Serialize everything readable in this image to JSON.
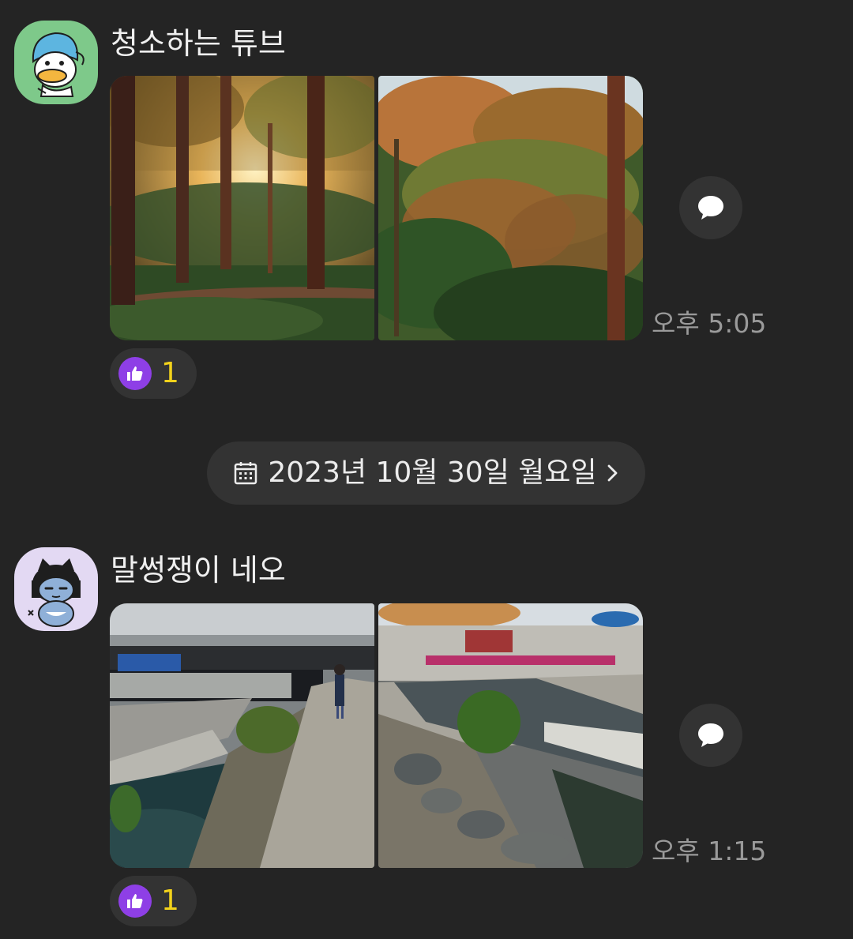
{
  "messages": [
    {
      "sender": "청소하는 튜브",
      "avatar_icon": "tube-duck-character-icon",
      "photos": [
        "autumn-forest-sunlight-photo",
        "autumn-hillside-trees-photo"
      ],
      "time": "오후 5:05",
      "reaction": {
        "icon": "thumbs-up-icon",
        "count": "1"
      }
    },
    {
      "sender": "말썽쟁이 네오",
      "avatar_icon": "neo-cat-character-icon",
      "photos": [
        "stream-walkway-under-bridge-photo",
        "stream-with-stepping-stones-photo"
      ],
      "time": "오후 1:15",
      "reaction": {
        "icon": "thumbs-up-icon",
        "count": "1"
      }
    }
  ],
  "date_divider": {
    "icon": "calendar-icon",
    "label": "2023년 10월 30일 월요일",
    "chevron": "chevron-right-icon"
  },
  "colors": {
    "background": "#242424",
    "bubble": "#333333",
    "reaction_accent": "#8e3fe6",
    "reaction_count": "#f2d21b",
    "time_text": "#9a9a9a"
  }
}
